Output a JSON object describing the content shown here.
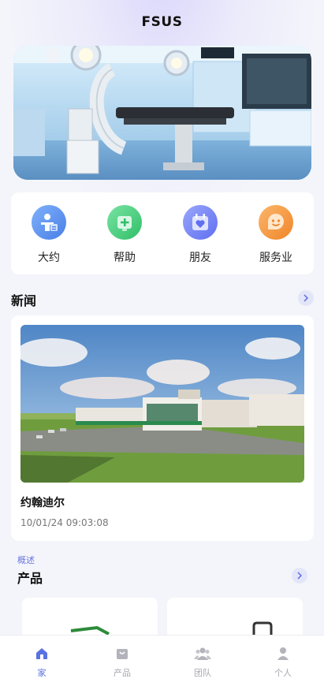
{
  "header": {
    "title": "FSUS"
  },
  "shortcuts": [
    {
      "label": "大约",
      "icon": "person-info-icon",
      "color": "#5b8ef0"
    },
    {
      "label": "帮助",
      "icon": "medical-kit-icon",
      "color": "#3fcf7a"
    },
    {
      "label": "朋友",
      "icon": "calendar-heart-icon",
      "color": "#6a7cf2"
    },
    {
      "label": "服务业",
      "icon": "smile-chat-icon",
      "color": "#f59a3a"
    }
  ],
  "news": {
    "section_title": "新闻",
    "items": [
      {
        "title": "约翰迪尔",
        "time": "10/01/24 09:03:08"
      }
    ]
  },
  "products": {
    "overline": "概述",
    "section_title": "产品"
  },
  "tabbar": {
    "items": [
      {
        "label": "家",
        "icon": "home-icon",
        "active": true
      },
      {
        "label": "产品",
        "icon": "bag-icon",
        "active": false
      },
      {
        "label": "团队",
        "icon": "team-icon",
        "active": false
      },
      {
        "label": "个人",
        "icon": "user-icon",
        "active": false
      }
    ]
  },
  "colors": {
    "accent": "#5a72e0",
    "background": "#f4f5fb"
  }
}
